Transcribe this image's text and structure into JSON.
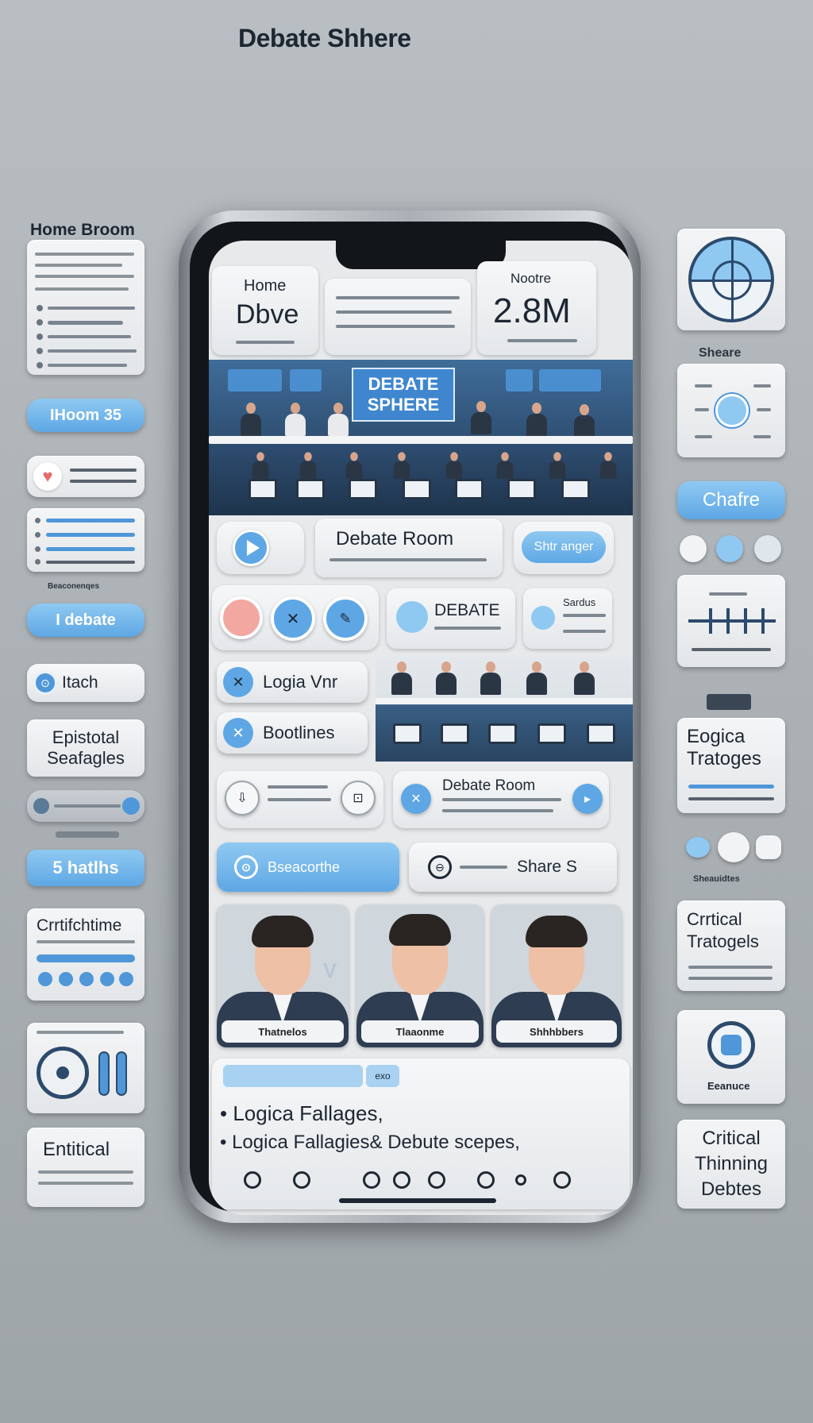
{
  "page_title": "Debate Shhere",
  "left_panel": {
    "header": "Home Broom",
    "pill_1": "IHoom 35",
    "section_label_1": "Beaconenqes",
    "pill_2": "I debate",
    "search_label": "Itach",
    "card_1": "Epistotal Seafagles",
    "pill_3": "5 hatlhs",
    "card_2": "Crrtifchtime",
    "card_3": "Entitical"
  },
  "right_panel": {
    "label_1": "Sheare",
    "share_button": "Chafre",
    "card_1": "Eogica Tratoges",
    "label_2": "Sheauidtes",
    "card_2": "Crrtical Tratogels",
    "label_3": "Eeanuce",
    "card_3": "Critical Thinning Debtes"
  },
  "screen": {
    "home_tile": {
      "title": "Home",
      "value": "Dbve"
    },
    "stat_tile": {
      "label": "Nootre",
      "value": "2.8M"
    },
    "banner_title": "DEBATE SPHERE",
    "debate_room_button": "Debate Room",
    "share_pill": "Shtr anger",
    "debate_card": "DEBATE",
    "debate_card_side": "Sardus",
    "logic_button": "Logia Vnr",
    "bootlines_button": "Bootlines",
    "debate_room_card": "Debate Room",
    "blue_action": "Bseacorthe",
    "share_action": "Share S",
    "avatars": [
      {
        "name": "Thatnelos"
      },
      {
        "name": "Tlaaonme"
      },
      {
        "name": "Shhhbbers"
      }
    ],
    "vs_label": "V",
    "tag_chip": "exo",
    "bullets": [
      "Logica Fallages,",
      "Logica Fallagies& Debute scepes,"
    ]
  },
  "colors": {
    "accent_blue": "#5ea7e4",
    "dark_navy": "#1d2733",
    "background": "#aeb4b8"
  }
}
